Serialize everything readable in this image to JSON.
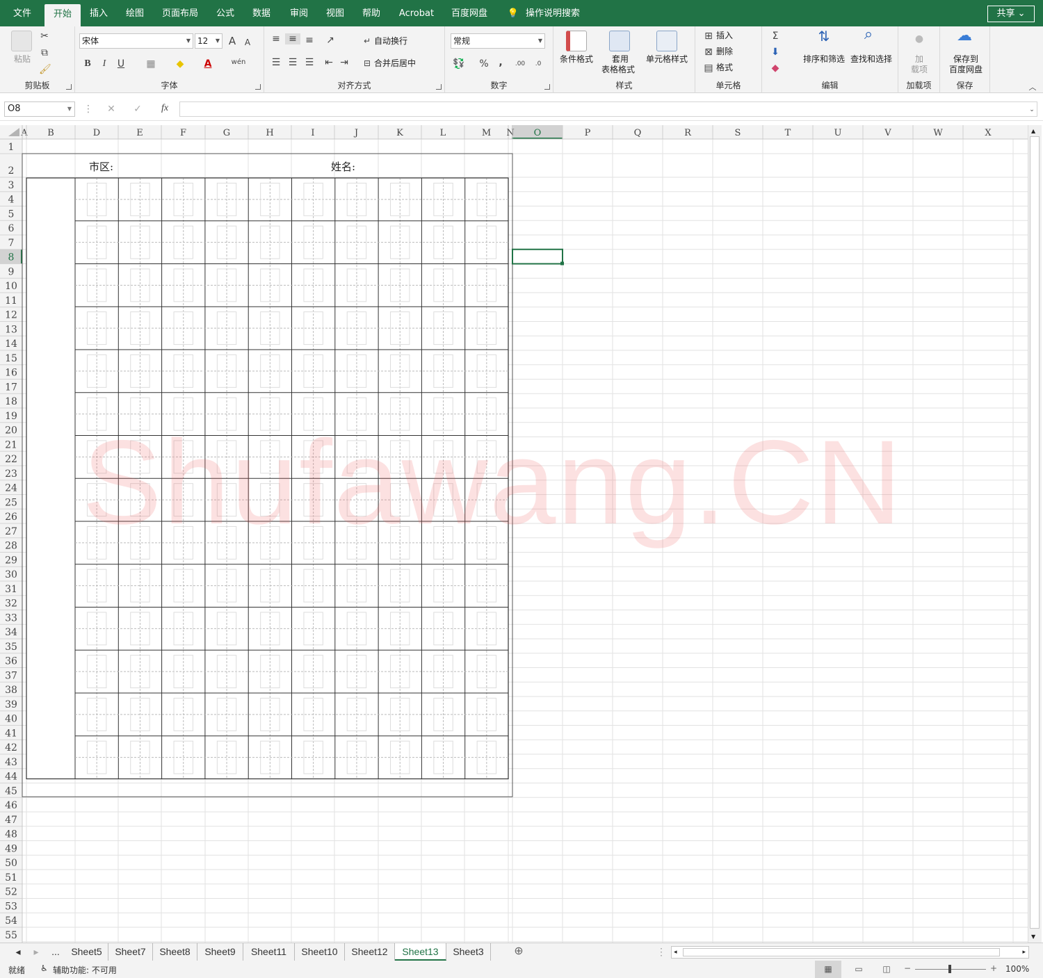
{
  "ribbon_tabs": [
    "文件",
    "开始",
    "插入",
    "绘图",
    "页面布局",
    "公式",
    "数据",
    "审阅",
    "视图",
    "帮助",
    "Acrobat",
    "百度网盘"
  ],
  "active_tab": "开始",
  "search_label": "操作说明搜索",
  "share_label": "共享",
  "clipboard": {
    "paste": "粘贴",
    "label": "剪贴板"
  },
  "font": {
    "name": "宋体",
    "size": "12",
    "label": "字体",
    "bold": "B",
    "italic": "I",
    "underline": "U",
    "grow": "A",
    "shrink": "A",
    "wen": "wén"
  },
  "alignment": {
    "wrap": "自动换行",
    "merge": "合并后居中",
    "label": "对齐方式"
  },
  "number": {
    "format": "常规",
    "percent": "%",
    "comma": ",",
    "label": "数字"
  },
  "styles": {
    "conditional": "条件格式",
    "table_format_1": "套用",
    "table_format_2": "表格格式",
    "cell_styles": "单元格样式",
    "label": "样式"
  },
  "cells": {
    "insert": "插入",
    "delete": "删除",
    "format": "格式",
    "label": "单元格"
  },
  "editing": {
    "sort_filter": "排序和筛选",
    "find_select": "查找和选择",
    "label": "编辑"
  },
  "addins": {
    "btn1": "加",
    "btn2": "载项",
    "label": "加载项"
  },
  "save": {
    "btn1": "保存到",
    "btn2": "百度网盘",
    "label": "保存"
  },
  "formula_bar": {
    "name_box": "O8",
    "fx": "fx",
    "cancel": "✕",
    "enter": "✓"
  },
  "columns": [
    "A",
    "B",
    "D",
    "E",
    "F",
    "G",
    "H",
    "I",
    "J",
    "K",
    "L",
    "M",
    "N",
    "O",
    "P",
    "Q",
    "R",
    "S",
    "T",
    "U",
    "V",
    "W",
    "X"
  ],
  "rows": [
    "1",
    "2",
    "3",
    "4",
    "5",
    "6",
    "7",
    "8",
    "9",
    "10",
    "11",
    "12",
    "13",
    "14",
    "15",
    "16",
    "17",
    "18",
    "19",
    "20",
    "21",
    "22",
    "23",
    "24",
    "25",
    "26",
    "27",
    "28",
    "29",
    "30",
    "31",
    "32",
    "33",
    "34",
    "35",
    "36",
    "37",
    "38",
    "39",
    "40",
    "41",
    "42",
    "43",
    "44",
    "45",
    "46",
    "47",
    "48",
    "49",
    "50",
    "51",
    "52",
    "53",
    "54",
    "55"
  ],
  "selected_cell": "O8",
  "sheet_labels": {
    "district": "市区:",
    "name": "姓名:"
  },
  "watermark": "Shufawang.CN",
  "sheet_tabs": [
    "Sheet5",
    "Sheet7",
    "Sheet8",
    "Sheet9",
    "Sheet11",
    "Sheet10",
    "Sheet12",
    "Sheet13",
    "Sheet3"
  ],
  "active_sheet": "Sheet13",
  "more_tabs": "...",
  "status": {
    "ready": "就绪",
    "accessibility": "辅助功能: 不可用",
    "zoom": "100%"
  }
}
